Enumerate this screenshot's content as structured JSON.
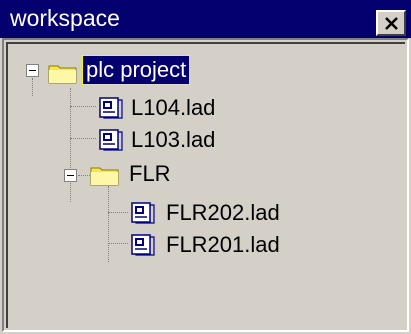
{
  "window": {
    "title": "workspace"
  },
  "tree": {
    "root": {
      "label": "plc project",
      "children": [
        {
          "label": "L104.lad",
          "icon": "ladder-file-icon"
        },
        {
          "label": "L103.lad",
          "icon": "ladder-file-icon"
        },
        {
          "label": "FLR",
          "icon": "folder-icon",
          "children": [
            {
              "label": "FLR202.lad",
              "icon": "ladder-file-icon"
            },
            {
              "label": "FLR201.lad",
              "icon": "ladder-file-icon"
            }
          ]
        }
      ]
    }
  },
  "colors": {
    "titlebar": "#040070",
    "selection": "#040070",
    "panel": "#d4d0c8",
    "folder": "#ffe34d"
  }
}
